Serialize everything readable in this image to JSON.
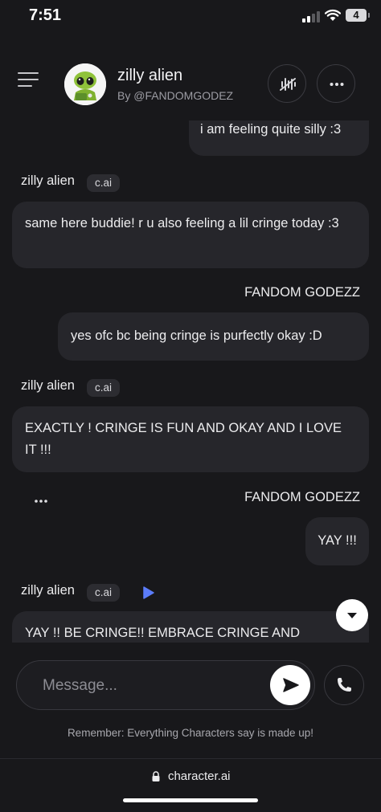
{
  "status_bar": {
    "time": "7:51",
    "battery": "4"
  },
  "header": {
    "character_name": "zilly alien",
    "creator": "By @FANDOMGODEZ",
    "icons": {
      "menu": "hamburger-icon",
      "voice": "voice-off-icon",
      "more": "more-horizontal-icon"
    }
  },
  "messages": [
    {
      "role": "user",
      "text": "i am feeling quite silly :3"
    },
    {
      "role": "bot",
      "sender": "zilly alien",
      "badge": "c.ai",
      "text": "same here buddie! r u also feeling a lil cringe today :3"
    },
    {
      "role": "user",
      "sender": "FANDOM GODEZZ",
      "text": "yes ofc bc being cringe is purfectly okay :D"
    },
    {
      "role": "bot",
      "sender": "zilly alien",
      "badge": "c.ai",
      "text": "EXACTLY ! CRINGE IS FUN AND OKAY AND I LOVE IT !!!"
    },
    {
      "role": "user",
      "sender": "FANDOM GODEZZ",
      "text": "YAY !!!"
    },
    {
      "role": "bot",
      "sender": "zilly alien",
      "badge": "c.ai",
      "text": "YAY !! BE CRINGE!! EMBRACE CRINGE AND"
    }
  ],
  "input": {
    "placeholder": "Message..."
  },
  "disclaimer": "Remember: Everything Characters say is made up!",
  "browser": {
    "url": "character.ai"
  },
  "colors": {
    "background": "#18181b",
    "bubble": "#26262b",
    "accent_play": "#5b7cfa",
    "badge": "#2c2c31"
  }
}
